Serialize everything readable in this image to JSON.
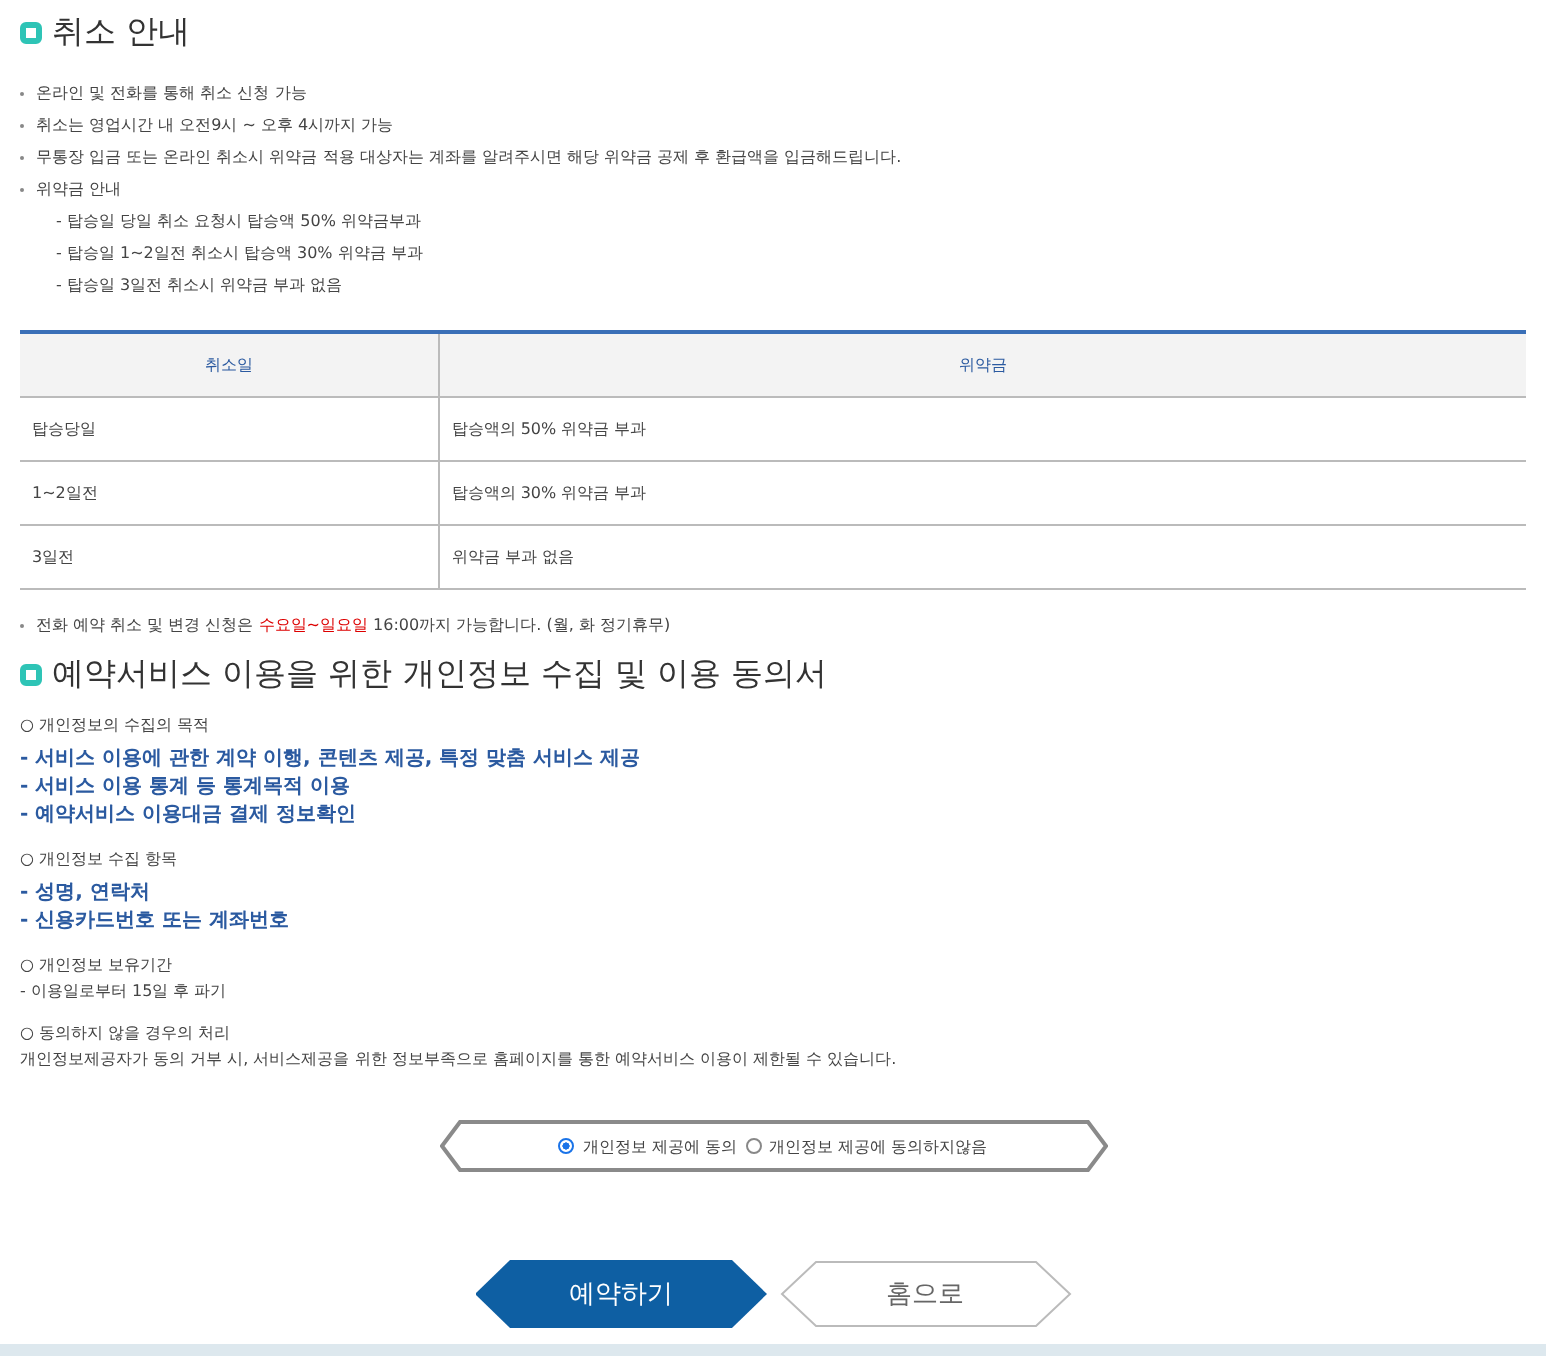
{
  "cancel_section": {
    "title": "취소 안내",
    "bullets": [
      {
        "text": "온라인 및 전화를 통해 취소 신청 가능"
      },
      {
        "text": "취소는 영업시간 내 오전9시 ~ 오후 4시까지 가능"
      },
      {
        "text": "무통장 입금 또는 온라인 취소시 위약금 적용 대상자는 계좌를 알려주시면 해당 위약금 공제 후 환급액을 입금해드립니다."
      },
      {
        "text": "위약금 안내",
        "sub_items": [
          "- 탑승일 당일 취소 요청시 탑승액 50% 위약금부과",
          "- 탑승일 1~2일전 취소시 탑승액 30% 위약금 부과",
          "- 탑승일 3일전 취소시 위약금 부과 없음"
        ]
      }
    ]
  },
  "table": {
    "columns": [
      "취소일",
      "위약금"
    ],
    "rows": [
      [
        "탑승당일",
        "탑승액의 50% 위약금 부과"
      ],
      [
        "1~2일전",
        "탑승액의 30% 위약금 부과"
      ],
      [
        "3일전",
        "위약금 부과 없음"
      ]
    ]
  },
  "phone_note": {
    "before": "전화 예약 취소 및 변경 신청은 ",
    "highlight": "수요일~일요일",
    "after": " 16:00까지 가능합니다. (월, 화 정기휴무)"
  },
  "privacy_section": {
    "title": "예약서비스 이용을 위한 개인정보 수집 및 이용 동의서",
    "sections": [
      {
        "heading": "○ 개인정보의 수집의 목적",
        "kind": "emphasis",
        "lines": [
          "- 서비스 이용에 관한 계약 이행, 콘텐츠 제공, 특정 맞춤 서비스 제공",
          "- 서비스 이용 통계 등 통계목적 이용",
          "- 예약서비스 이용대금 결제 정보확인"
        ]
      },
      {
        "heading": "○ 개인정보 수집 항목",
        "kind": "emphasis",
        "lines": [
          "- 성명, 연락처",
          "- 신용카드번호 또는 계좌번호"
        ]
      },
      {
        "heading": "○ 개인정보 보유기간",
        "kind": "plain",
        "lines": [
          "- 이용일로부터 15일 후 파기"
        ]
      },
      {
        "heading": "○ 동의하지 않을 경우의 처리",
        "kind": "plain",
        "lines": [
          "개인정보제공자가 동의 거부 시, 서비스제공을 위한 정보부족으로 홈페이지를 통한 예약서비스 이용이 제한될 수 있습니다."
        ]
      }
    ]
  },
  "consent": {
    "options": [
      {
        "label": "개인정보 제공에 동의",
        "selected": true
      },
      {
        "label": "개인정보 제공에 동의하지않음",
        "selected": false
      }
    ]
  },
  "buttons": [
    {
      "label": "예약하기",
      "kind": "primary"
    },
    {
      "label": "홈으로",
      "kind": "secondary"
    }
  ]
}
